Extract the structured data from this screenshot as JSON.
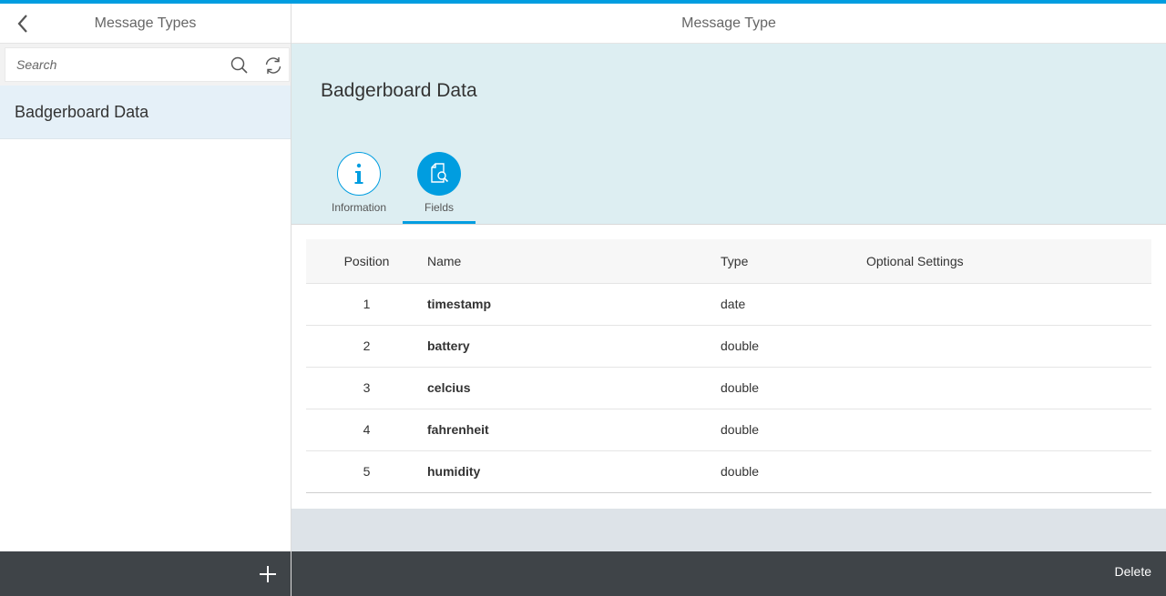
{
  "master": {
    "title": "Message Types",
    "search_placeholder": "Search",
    "items": [
      {
        "label": "Badgerboard Data",
        "selected": true
      }
    ]
  },
  "detail": {
    "title": "Message Type",
    "object_title": "Badgerboard Data",
    "tabs": [
      {
        "label": "Information",
        "icon": "info-icon",
        "selected": false
      },
      {
        "label": "Fields",
        "icon": "document-search-icon",
        "selected": true
      }
    ],
    "table": {
      "columns": [
        "Position",
        "Name",
        "Type",
        "Optional Settings"
      ],
      "rows": [
        {
          "position": "1",
          "name": "timestamp",
          "type": "date",
          "settings": ""
        },
        {
          "position": "2",
          "name": "battery",
          "type": "double",
          "settings": ""
        },
        {
          "position": "3",
          "name": "celcius",
          "type": "double",
          "settings": ""
        },
        {
          "position": "4",
          "name": "fahrenheit",
          "type": "double",
          "settings": ""
        },
        {
          "position": "5",
          "name": "humidity",
          "type": "double",
          "settings": ""
        }
      ]
    },
    "footer": {
      "delete_label": "Delete"
    }
  },
  "colors": {
    "accent": "#009de0",
    "footer": "#3f4448",
    "selected_item": "#e5f0f8",
    "object_header": "#ddeef2"
  }
}
